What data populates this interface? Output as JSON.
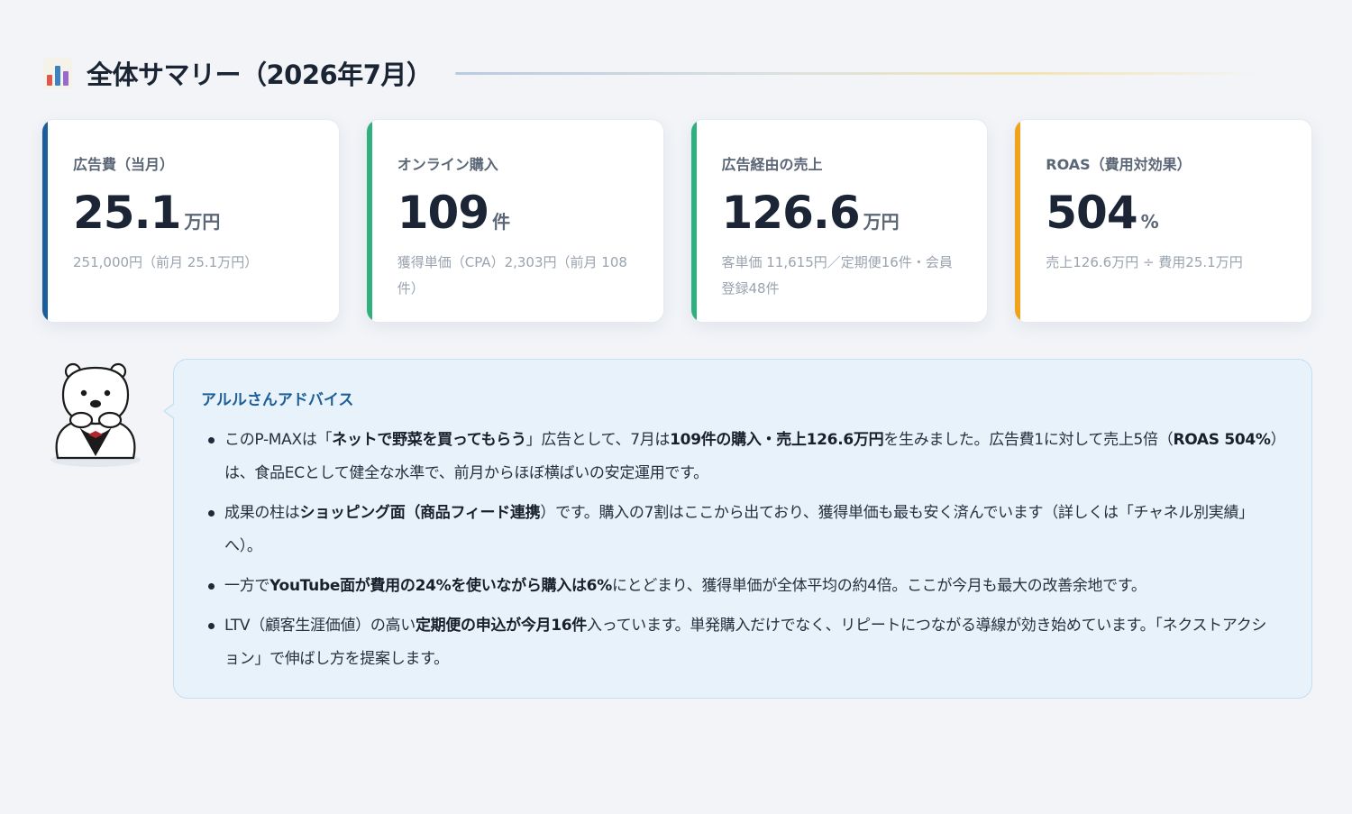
{
  "header": {
    "icon": "bar-chart-icon",
    "title": "全体サマリー（2026年7月）"
  },
  "kpis": [
    {
      "label": "広告費（当月）",
      "value": "25.1",
      "unit": "万円",
      "sub": "251,000円（前月 25.1万円）",
      "accent": "#1a5e9e"
    },
    {
      "label": "オンライン購入",
      "value": "109",
      "unit": "件",
      "sub": "獲得単価（CPA）2,303円（前月 108件）",
      "accent": "#2fb07f"
    },
    {
      "label": "広告経由の売上",
      "value": "126.6",
      "unit": "万円",
      "sub": "客単価 11,615円／定期便16件・会員登録48件",
      "accent": "#2fb07f"
    },
    {
      "label": "ROAS（費用対効果）",
      "value": "504",
      "unit": "%",
      "sub": "売上126.6万円 ÷ 費用25.1万円",
      "accent": "#f0a21a"
    }
  ],
  "mascot": {
    "icon": "polar-bear-mascot-icon"
  },
  "advice": {
    "title": "アルルさんアドバイス",
    "items": [
      [
        {
          "t": "このP-MAXは「"
        },
        {
          "t": "ネットで野菜を買ってもらう",
          "b": true
        },
        {
          "t": "」広告として、7月は"
        },
        {
          "t": "109件の購入・売上126.6万円",
          "b": true
        },
        {
          "t": "を生みました。広告費1に対して売上5倍（"
        },
        {
          "t": "ROAS 504%",
          "b": true
        },
        {
          "t": "）は、食品ECとして健全な水準で、前月からほぼ横ばいの安定運用です。"
        }
      ],
      [
        {
          "t": "成果の柱は"
        },
        {
          "t": "ショッピング面（商品フィード連携",
          "b": true
        },
        {
          "t": "）です。購入の7割はここから出ており、獲得単価も最も安く済んでいます（詳しくは「チャネル別実績」へ）。"
        }
      ],
      [
        {
          "t": "一方で"
        },
        {
          "t": "YouTube面が費用の24%を使いながら購入は6%",
          "b": true
        },
        {
          "t": "にとどまり、獲得単価が全体平均の約4倍。ここが今月も最大の改善余地です。"
        }
      ],
      [
        {
          "t": "LTV（顧客生涯価値）の高い"
        },
        {
          "t": "定期便の申込が今月16件",
          "b": true
        },
        {
          "t": "入っています。単発購入だけでなく、リピートにつながる導線が効き始めています。「ネクストアクション」で伸ばし方を提案します。"
        }
      ]
    ]
  }
}
